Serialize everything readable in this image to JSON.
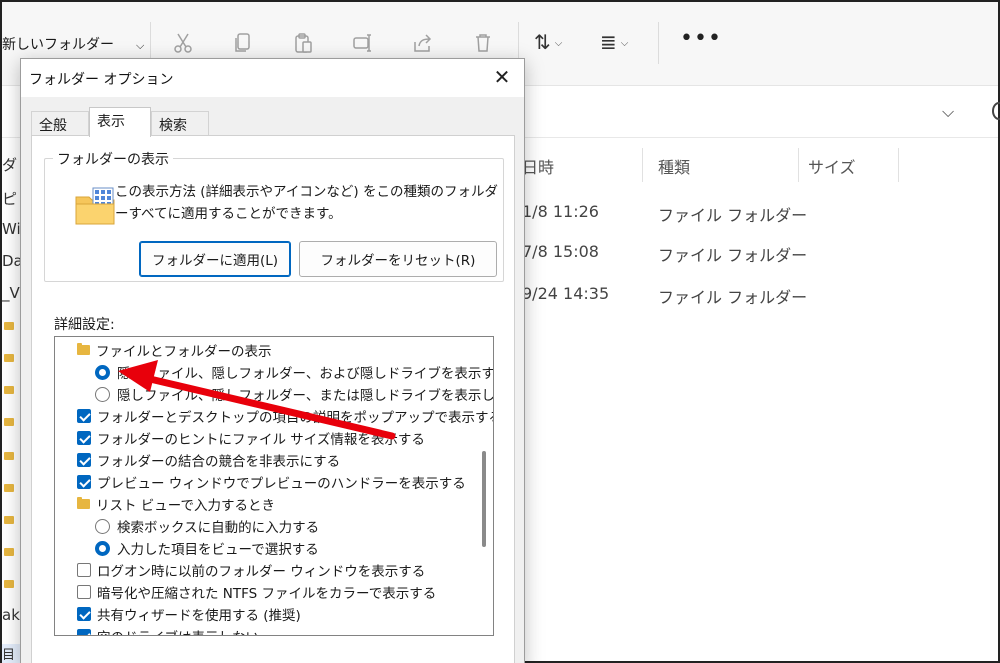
{
  "explorer": {
    "toolbar": {
      "new_folder": "新しいフォルダー"
    },
    "columns": {
      "date": "日時",
      "type": "種類",
      "size": "サイズ"
    },
    "rows": [
      {
        "date": "1/8 11:26",
        "type": "ファイル フォルダー"
      },
      {
        "date": "7/8 15:08",
        "type": "ファイル フォルダー"
      },
      {
        "date": "9/24 14:35",
        "type": "ファイル フォルダー"
      }
    ],
    "left_items": [
      "ダ",
      "ピ",
      "Wi",
      "Da",
      "_V",
      "_",
      "_",
      "_",
      "_",
      "p",
      "p",
      "P",
      "S",
      "ネ",
      "ak"
    ],
    "status_left": "目"
  },
  "dialog": {
    "title": "フォルダー オプション",
    "tabs": [
      "全般",
      "表示",
      "検索"
    ],
    "active_tab": 1,
    "folder_view": {
      "legend": "フォルダーの表示",
      "description": "この表示方法 (詳細表示やアイコンなど) をこの種類のフォルダーすべてに適用することができます。",
      "apply_button": "フォルダーに適用(L)",
      "reset_button": "フォルダーをリセット(R)"
    },
    "advanced": {
      "label": "詳細設定:",
      "items": [
        {
          "kind": "folder",
          "indent": 0,
          "label": "ファイルとフォルダーの表示"
        },
        {
          "kind": "radio",
          "checked": true,
          "indent": 1,
          "label": "隠しファイル、隠しフォルダー、および隠しドライブを表示する"
        },
        {
          "kind": "radio",
          "checked": false,
          "indent": 1,
          "label": "隠しファイル、隠しフォルダー、または隠しドライブを表示しない"
        },
        {
          "kind": "check",
          "checked": true,
          "indent": 0,
          "label": "フォルダーとデスクトップの項目の説明をポップアップで表示する"
        },
        {
          "kind": "check",
          "checked": true,
          "indent": 0,
          "label": "フォルダーのヒントにファイル サイズ情報を表示する"
        },
        {
          "kind": "check",
          "checked": true,
          "indent": 0,
          "label": "フォルダーの結合の競合を非表示にする"
        },
        {
          "kind": "check",
          "checked": true,
          "indent": 0,
          "label": "プレビュー ウィンドウでプレビューのハンドラーを表示する"
        },
        {
          "kind": "folder",
          "indent": 0,
          "label": "リスト ビューで入力するとき"
        },
        {
          "kind": "radio",
          "checked": false,
          "indent": 1,
          "label": "検索ボックスに自動的に入力する"
        },
        {
          "kind": "radio",
          "checked": true,
          "indent": 1,
          "label": "入力した項目をビューで選択する"
        },
        {
          "kind": "check",
          "checked": false,
          "indent": 0,
          "label": "ログオン時に以前のフォルダー ウィンドウを表示する"
        },
        {
          "kind": "check",
          "checked": false,
          "indent": 0,
          "label": "暗号化や圧縮された NTFS ファイルをカラーで表示する"
        },
        {
          "kind": "check",
          "checked": true,
          "indent": 0,
          "label": "共有ウィザードを使用する (推奨)"
        },
        {
          "kind": "check",
          "checked": true,
          "indent": 0,
          "label": "空のドライブは表示しない"
        }
      ]
    }
  },
  "colors": {
    "accent": "#0067c0",
    "arrow": "#e8000b",
    "folder": "#e7b640"
  }
}
